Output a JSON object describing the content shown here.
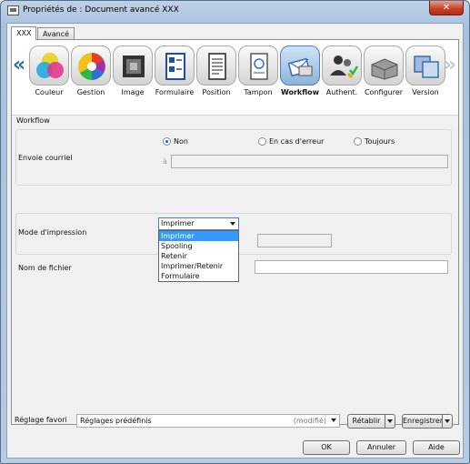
{
  "window": {
    "title": "Propriétés de : Document avancé XXX",
    "close_glyph": "✕"
  },
  "tabs": [
    {
      "label": "XXX"
    },
    {
      "label": "Avancé"
    }
  ],
  "toolbar": {
    "items": [
      {
        "label": "Couleur",
        "icon": "color-balls-icon"
      },
      {
        "label": "Gestion",
        "icon": "color-wheel-icon"
      },
      {
        "label": "Image",
        "icon": "image-icon"
      },
      {
        "label": "Formulaire",
        "icon": "form-icon"
      },
      {
        "label": "Position",
        "icon": "document-icon"
      },
      {
        "label": "Tampon",
        "icon": "stamp-icon"
      },
      {
        "label": "Workflow",
        "icon": "workflow-icon"
      },
      {
        "label": "Authent.",
        "icon": "users-icon"
      },
      {
        "label": "Configurer",
        "icon": "printer-icon"
      },
      {
        "label": "Version",
        "icon": "windows-icon"
      }
    ],
    "left_arrow": "«",
    "right_arrow": "»",
    "active": "Workflow"
  },
  "section_title": "Workflow",
  "email": {
    "label": "Envoie courriel",
    "options": [
      "Non",
      "En cas d'erreur",
      "Toujours"
    ],
    "selected": "Non",
    "to_label": "à",
    "to_value": ""
  },
  "print_mode": {
    "label": "Mode d'impression",
    "selected": "Imprimer",
    "options": [
      "Imprimer",
      "Spooling",
      "Retenir",
      "Imprimer/Retenir",
      "Formulaire"
    ],
    "highlighted": "Imprimer"
  },
  "filename": {
    "label": "Nom de fichier",
    "value": ""
  },
  "favorites": {
    "label": "Réglage favori",
    "value": "Réglages prédéfinis",
    "modified": "(modifié)",
    "restore_label": "Rétablir",
    "save_label": "Enregistrer"
  },
  "buttons": {
    "ok": "OK",
    "cancel": "Annuler",
    "help": "Aide"
  }
}
